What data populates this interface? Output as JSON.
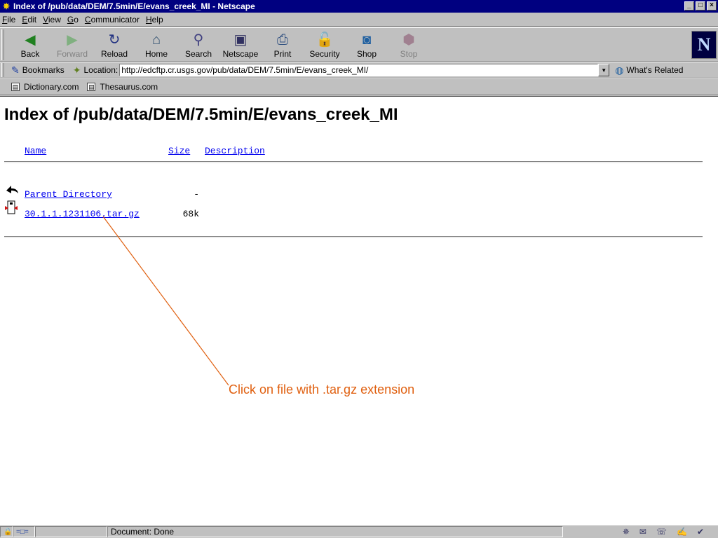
{
  "window": {
    "title": "Index of /pub/data/DEM/7.5min/E/evans_creek_MI - Netscape",
    "buttons": [
      "_",
      "□",
      "×"
    ]
  },
  "menu": [
    {
      "u": "F",
      "rest": "ile"
    },
    {
      "u": "E",
      "rest": "dit"
    },
    {
      "u": "V",
      "rest": "iew"
    },
    {
      "u": "G",
      "rest": "o"
    },
    {
      "u": "C",
      "rest": "ommunicator"
    },
    {
      "u": "H",
      "rest": "elp"
    }
  ],
  "navbar": {
    "back": "Back",
    "forward": "Forward",
    "reload": "Reload",
    "home": "Home",
    "search": "Search",
    "netscape": "Netscape",
    "print": "Print",
    "security": "Security",
    "shop": "Shop",
    "stop": "Stop",
    "logo": "N"
  },
  "location": {
    "bookmarks": "Bookmarks",
    "label": "Location:",
    "url": "http://edcftp.cr.usgs.gov/pub/data/DEM/7.5min/E/evans_creek_MI/",
    "whats_related": "What's Related"
  },
  "personal": {
    "item1": "Dictionary.com",
    "item2": "Thesaurus.com"
  },
  "page": {
    "title": "Index of /pub/data/DEM/7.5min/E/evans_creek_MI",
    "col_name": "Name",
    "col_size": "Size",
    "col_desc": "Description",
    "rows": [
      {
        "name": "Parent Directory",
        "size": "-"
      },
      {
        "name": "30.1.1.1231106.tar.gz",
        "size": "68k"
      }
    ]
  },
  "annotation": {
    "text": "Click on file with .tar.gz extension",
    "color": "#e06010"
  },
  "status": {
    "text": "Document: Done"
  }
}
